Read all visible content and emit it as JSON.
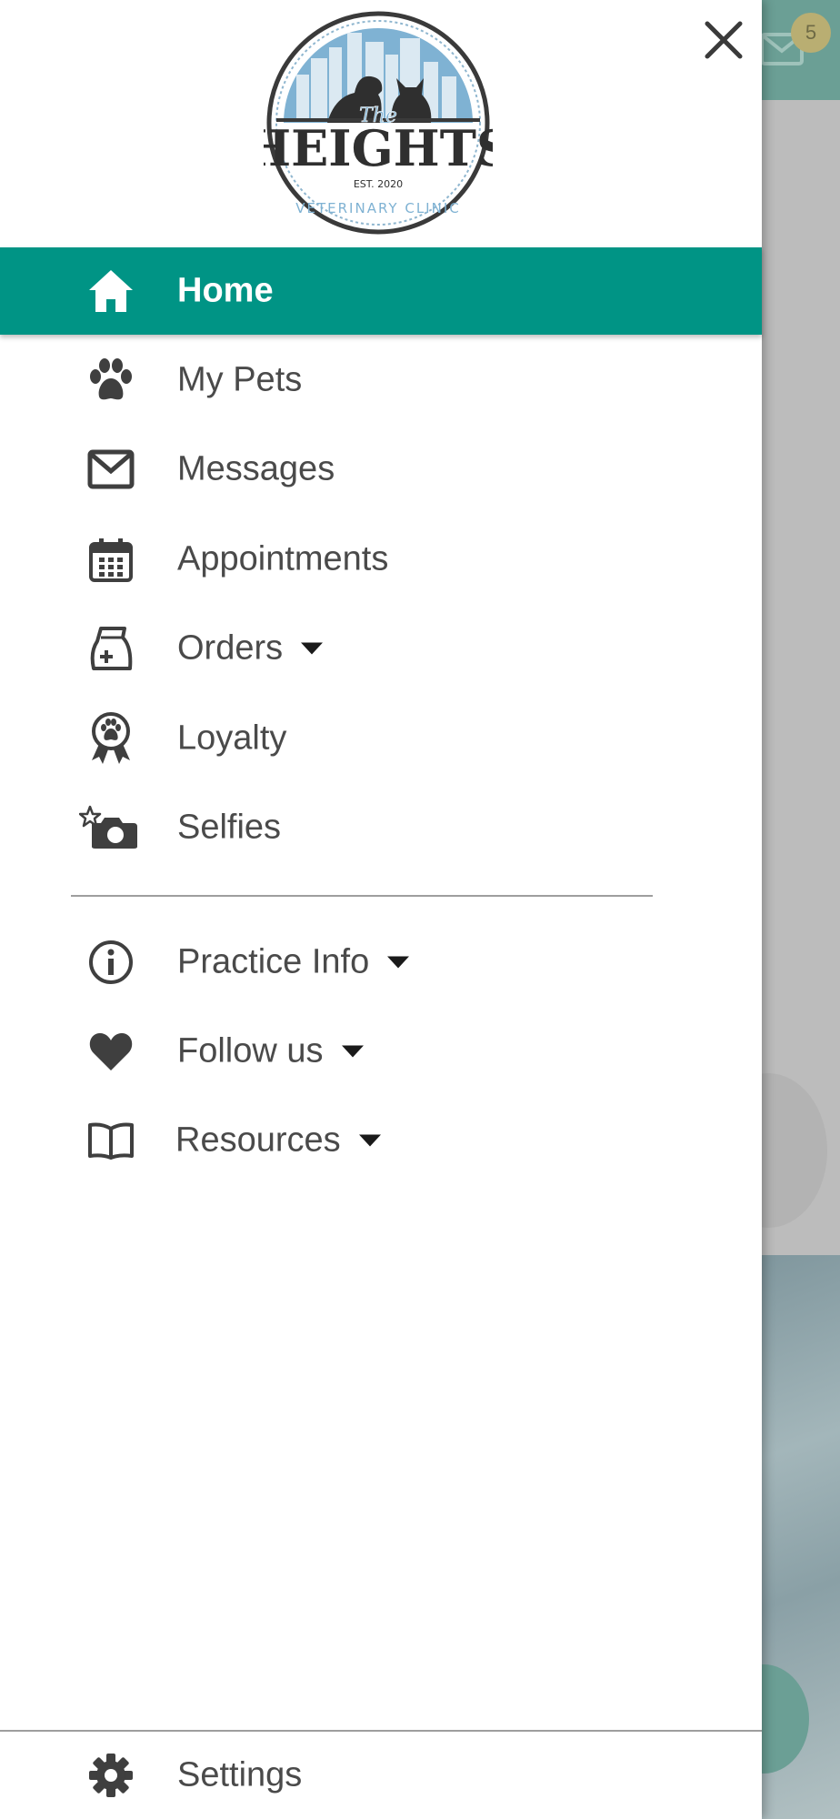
{
  "background": {
    "notification_count": "5",
    "header_color": "#6b9f95"
  },
  "drawer": {
    "logo": {
      "script_text": "The",
      "name": "HEIGHTS",
      "est": "EST. 2020",
      "subtitle": "VETERINARY CLINIC"
    },
    "menu": [
      {
        "label": "Home",
        "icon": "home-icon",
        "active": true
      },
      {
        "label": "My Pets",
        "icon": "paw-icon"
      },
      {
        "label": "Messages",
        "icon": "envelope-icon"
      },
      {
        "label": "Appointments",
        "icon": "calendar-icon"
      },
      {
        "label": "Orders",
        "icon": "food-bag-icon",
        "has_dropdown": true
      },
      {
        "label": "Loyalty",
        "icon": "award-ribbon-icon"
      },
      {
        "label": "Selfies",
        "icon": "camera-icon"
      }
    ],
    "secondary_menu": [
      {
        "label": "Practice Info",
        "icon": "info-icon",
        "has_dropdown": true
      },
      {
        "label": "Follow us",
        "icon": "heart-icon",
        "has_dropdown": true
      },
      {
        "label": "Resources",
        "icon": "book-icon",
        "has_dropdown": true
      }
    ],
    "footer": {
      "label": "Settings",
      "icon": "gear-icon"
    }
  },
  "colors": {
    "accent": "#009485",
    "text": "#4a4a4a",
    "icon": "#3f3f3f"
  }
}
